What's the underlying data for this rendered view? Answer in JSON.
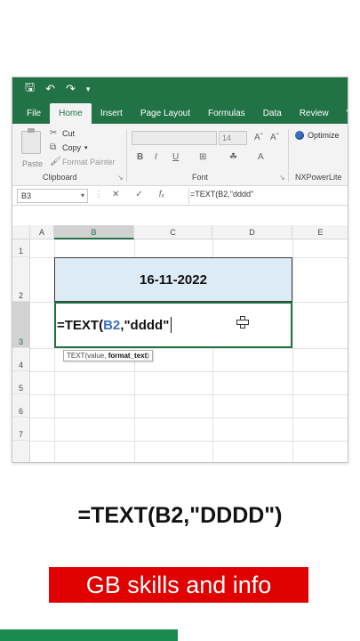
{
  "qat": {
    "save_icon": "save-icon",
    "undo_icon": "undo-icon",
    "redo_icon": "redo-icon",
    "more_icon": "customize-icon"
  },
  "tabs": [
    "File",
    "Home",
    "Insert",
    "Page Layout",
    "Formulas",
    "Data",
    "Review",
    "Vie"
  ],
  "ribbon": {
    "paste_label": "Paste",
    "cut_label": "Cut",
    "copy_label": "Copy",
    "format_painter_label": "Format Painter",
    "clipboard_label": "Clipboard",
    "font_size": "14",
    "font_label": "Font",
    "optimize_label": "Optimize",
    "nxpowerlite_label": "NXPowerLite"
  },
  "formula_bar": {
    "name_box": "B3",
    "formula": "=TEXT(B2,\"dddd\""
  },
  "columns": [
    "A",
    "B",
    "C",
    "D",
    "E"
  ],
  "rows": [
    "1",
    "2",
    "3",
    "4",
    "5",
    "6",
    "7"
  ],
  "cells": {
    "b2_value": "16-11-2022",
    "b3_prefix": "=TEXT(",
    "b3_ref": "B2",
    "b3_suffix": ",\"dddd\""
  },
  "tooltip": {
    "func": "TEXT(value, ",
    "arg": "format_text",
    "end": ")"
  },
  "caption": "=TEXT(B2,\"DDDD\")",
  "banner": "GB skills and info",
  "colors": {
    "excel_green": "#217346",
    "banner_red": "#e00000",
    "b2_fill": "#ddebf7"
  }
}
